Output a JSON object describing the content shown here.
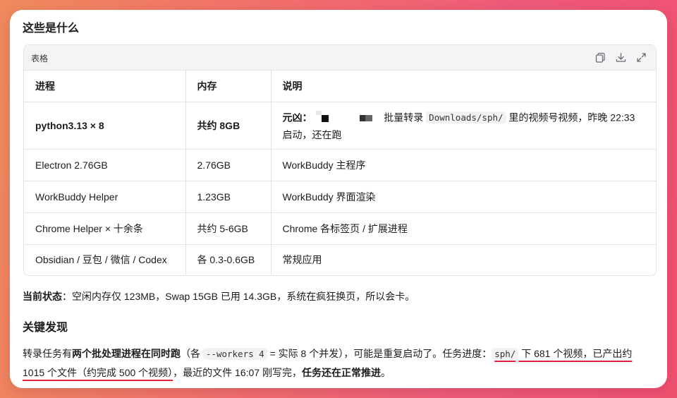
{
  "heading": "这些是什么",
  "table": {
    "title": "表格",
    "actions": [
      "copy-icon",
      "download-icon",
      "expand-icon"
    ],
    "columns": [
      "进程",
      "内存",
      "说明"
    ],
    "rows": [
      {
        "process": "python3.13 × 8",
        "memory": "共约 8GB",
        "desc_label": "元凶：",
        "desc_pre": "批量转录",
        "desc_code": "Downloads/sph/",
        "desc_post": "里的视频号视频，昨晚 22:33 启动，还在跑"
      },
      {
        "process": "Electron 2.76GB",
        "memory": "2.76GB",
        "desc": "WorkBuddy 主程序"
      },
      {
        "process": "WorkBuddy Helper",
        "memory": "1.23GB",
        "desc": "WorkBuddy 界面渲染"
      },
      {
        "process": "Chrome Helper × 十余条",
        "memory": "共约 5-6GB",
        "desc": "Chrome 各标签页 / 扩展进程"
      },
      {
        "process": "Obsidian / 豆包 / 微信 / Codex",
        "memory": "各 0.3-0.6GB",
        "desc": "常规应用"
      }
    ]
  },
  "status": {
    "label": "当前状态",
    "text": "：空闲内存仅 123MB，Swap 15GB 已用 14.3GB，系统在疯狂换页，所以会卡。"
  },
  "findings": {
    "heading": "关键发现",
    "p1": "转录任务有",
    "p2": "两个批处理进程在同时跑",
    "p3": "（各 ",
    "p4": "--workers 4",
    "p5": " = 实际 8 个并发），可能是重复启动了。任务进度：",
    "p6": "sph/",
    "p7": " 下 681 个视频，已产出约",
    "p8": "1015 个文件（约完成 500 个视频）",
    "p9": "，最近的文件 16:07 刚写完，",
    "p10": "任务还在正常推进",
    "p11": "。"
  }
}
